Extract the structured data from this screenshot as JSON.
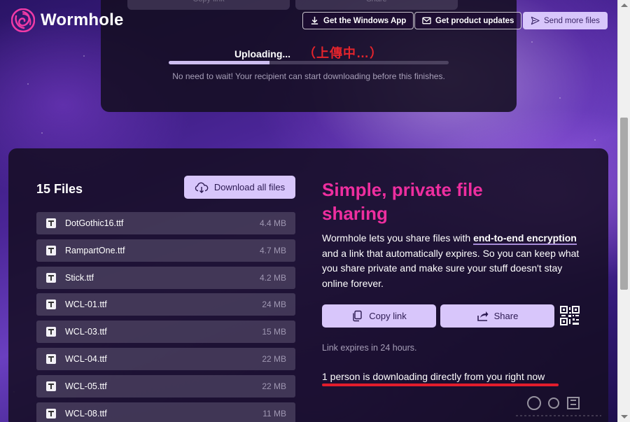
{
  "header": {
    "brand": "Wormhole",
    "windows_app_label": "Get the Windows App",
    "updates_label": "Get product updates",
    "send_more_label": "Send more files"
  },
  "upload": {
    "ghost_copy": "Copy link",
    "ghost_share": "Share",
    "status": "Uploading...",
    "annotation_cn": "（上傳中…）",
    "progress": 0.36,
    "note": "No need to wait! Your recipient can start downloading before this finishes."
  },
  "files": {
    "title": "15 Files",
    "download_all_label": "Download all files",
    "items": [
      {
        "name": "DotGothic16.ttf",
        "size": "4.4 MB"
      },
      {
        "name": "RampartOne.ttf",
        "size": "4.7 MB"
      },
      {
        "name": "Stick.ttf",
        "size": "4.2 MB"
      },
      {
        "name": "WCL-01.ttf",
        "size": "24 MB"
      },
      {
        "name": "WCL-03.ttf",
        "size": "15 MB"
      },
      {
        "name": "WCL-04.ttf",
        "size": "22 MB"
      },
      {
        "name": "WCL-05.ttf",
        "size": "22 MB"
      },
      {
        "name": "WCL-08.ttf",
        "size": "11 MB"
      }
    ]
  },
  "info": {
    "headline": "Simple, private file sharing",
    "desc_part1": "Wormhole lets you share files with ",
    "desc_link": "end-to-end encryption",
    "desc_part2": " and a link that automatically expires. So you can keep what you share private and make sure your stuff doesn't stay online forever.",
    "copy_link_label": "Copy link",
    "share_label": "Share",
    "expires": "Link expires in 24 hours.",
    "downloading_status": "1 person is downloading directly from you right now"
  },
  "colors": {
    "accent_pink": "#ee2e9f",
    "button_lavender": "#d8c6fb",
    "annotation_red": "#e21c2c"
  }
}
